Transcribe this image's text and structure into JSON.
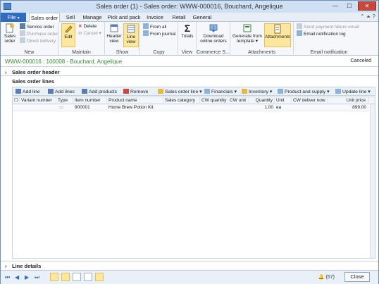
{
  "window": {
    "title": "Sales order (1) - Sales order: WWW-000016, Bouchard, Angelique",
    "minimize": "—",
    "maximize": "☐",
    "close": "✕"
  },
  "tabs": [
    {
      "label": "File"
    },
    {
      "label": "Sales order"
    },
    {
      "label": "Sell"
    },
    {
      "label": "Manage"
    },
    {
      "label": "Pick and pack"
    },
    {
      "label": "Invoice"
    },
    {
      "label": "Retail"
    },
    {
      "label": "General"
    }
  ],
  "ribbon": {
    "new": {
      "label": "New",
      "sales_order": "Sales order",
      "service_order": "Service order",
      "purchase_order": "Purchase order",
      "direct_delivery": "Direct delivery"
    },
    "maintain": {
      "label": "Maintain",
      "edit": "Edit",
      "delete": "Delete",
      "cancel": "Cancel"
    },
    "show": {
      "label": "Show",
      "header_view": "Header view",
      "line_view": "Line view"
    },
    "copy": {
      "label": "Copy",
      "from_all": "From all",
      "from_journal": "From journal"
    },
    "view": {
      "label": "View",
      "totals": "Totals"
    },
    "commerce": {
      "label": "Commerce S...",
      "download": "Download online orders"
    },
    "attachments": {
      "label": "Attachments",
      "generate": "Generate from template",
      "attachments": "Attachments"
    },
    "email": {
      "label": "Email notification",
      "send_failure": "Send payment failure email",
      "log": "Email notification log"
    }
  },
  "breadcrumb": {
    "text": "WWW-000016 : 100008 - Bouchard, Angelique",
    "status": "Canceled"
  },
  "sections": {
    "header": "Sales order header",
    "lines": "Sales order lines",
    "line_details": "Line details"
  },
  "toolbar": {
    "add_line": "Add line",
    "add_lines": "Add lines",
    "add_products": "Add products",
    "remove": "Remove",
    "sales_order_line": "Sales order line",
    "financials": "Financials",
    "inventory": "Inventory",
    "product_supply": "Product and supply",
    "update_line": "Update line"
  },
  "grid": {
    "columns": [
      "Variant number",
      "Type",
      "Item number",
      "Product name",
      "Sales category",
      "CW quantity",
      "CW unit",
      "Quantity",
      "Unit",
      "CW deliver now",
      "Unit price"
    ],
    "rows": [
      {
        "variant": "",
        "type": "▭",
        "item": "900001",
        "product": "Home Brew Potion Kit",
        "category": "",
        "cw_qty": "",
        "cw_unit": "",
        "qty": "1.00",
        "unit": "ea",
        "cw_deliver": "",
        "price": "899.00"
      }
    ]
  },
  "status": {
    "alerts": "(57)",
    "close": "Close"
  },
  "colors": {
    "accent": "#2f6cc0",
    "selected": "#fce79c",
    "breadcrumb": "#3a8a3a"
  }
}
